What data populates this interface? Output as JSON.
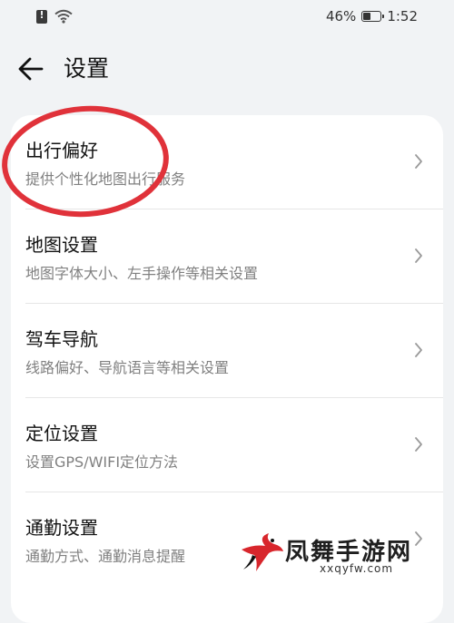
{
  "status_bar": {
    "battery_percent": "46%",
    "battery_level": 0.46,
    "time": "1:52",
    "icons": [
      "sim-alert-icon",
      "wifi-icon",
      "battery-icon"
    ]
  },
  "header": {
    "back_icon": "arrow-left-icon",
    "title": "设置"
  },
  "settings": {
    "items": [
      {
        "title": "出行偏好",
        "subtitle": "提供个性化地图出行服务"
      },
      {
        "title": "地图设置",
        "subtitle": "地图字体大小、左手操作等相关设置"
      },
      {
        "title": "驾车导航",
        "subtitle": "线路偏好、导航语言等相关设置"
      },
      {
        "title": "定位设置",
        "subtitle": "设置GPS/WIFI定位方法"
      },
      {
        "title": "通勤设置",
        "subtitle": "通勤方式、通勤消息提醒"
      }
    ],
    "chevron_icon": "chevron-right-icon"
  },
  "annotation": {
    "color": "#e0323a"
  },
  "watermark": {
    "name": "凤舞手游网",
    "url": "xxqyfw.com",
    "color": "#d8262c"
  }
}
